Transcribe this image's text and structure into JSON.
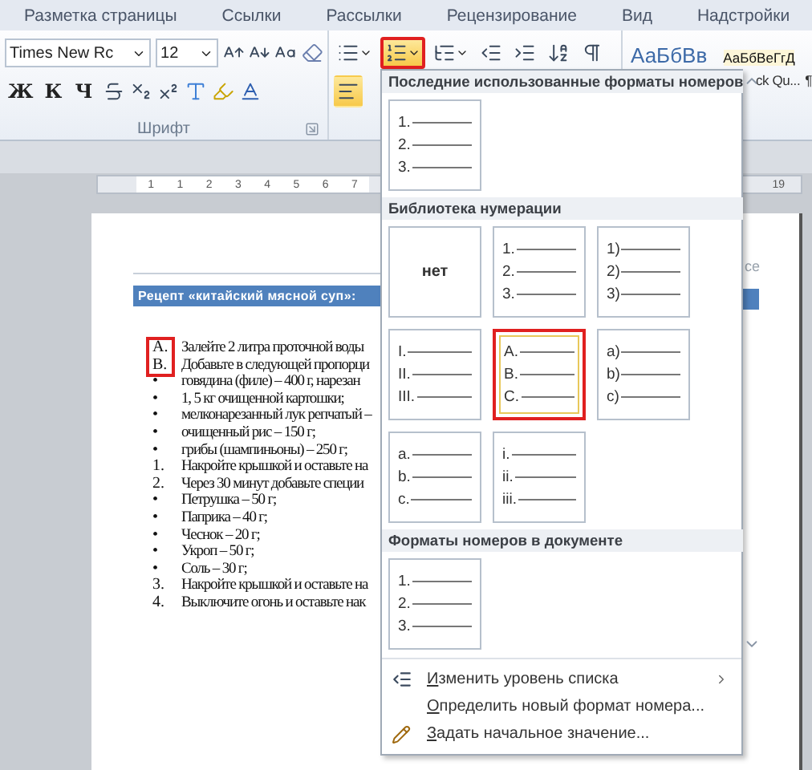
{
  "ribbon_tabs": [
    "Разметка страницы",
    "Ссылки",
    "Рассылки",
    "Рецензирование",
    "Вид",
    "Надстройки"
  ],
  "font_group": {
    "font_name": "Times New Rc",
    "font_size": "12",
    "style_letters": [
      "Ж",
      "К",
      "Ч"
    ],
    "label": "Шрифт"
  },
  "paragraph_buttons": [
    {
      "kind": "bullets",
      "selected": false,
      "annotated": false
    },
    {
      "kind": "numbering",
      "selected": true,
      "annotated": true
    },
    {
      "kind": "multilevel",
      "selected": false,
      "annotated": false
    },
    {
      "kind": "outdent",
      "selected": false,
      "annotated": false
    },
    {
      "kind": "indent",
      "selected": false,
      "annotated": false
    },
    {
      "kind": "sort",
      "selected": false,
      "annotated": false
    },
    {
      "kind": "pilcrow",
      "selected": false,
      "annotated": false
    }
  ],
  "align_buttons": [
    {
      "kind": "align-left",
      "selected": true
    }
  ],
  "styles_gallery": {
    "samples": [
      "АаБбВв",
      "АаБбВеГгД"
    ],
    "captions": [
      "ck Qu...",
      "¶"
    ]
  },
  "ruler": {
    "labels": [
      "1",
      "1",
      "2",
      "3",
      "4",
      "5",
      "6",
      "7"
    ],
    "right_label": "19"
  },
  "document": {
    "header_fragment": "ce",
    "heading": "Рецепт «китайский мясной суп»:",
    "items": [
      {
        "marker": "A.",
        "text": "Залейте 2 литра проточной воды",
        "annotated": true
      },
      {
        "marker": "B.",
        "text": "Добавьте в следующей пропорци",
        "annotated": true
      },
      {
        "marker": "•",
        "text": "говядина (филе) – 400 г, нарезан",
        "annotated": false
      },
      {
        "marker": "•",
        "text": "1, 5 кг очищенной картошки;",
        "annotated": false
      },
      {
        "marker": "•",
        "text": "мелконарезанный лук репчатый –",
        "annotated": false
      },
      {
        "marker": "•",
        "text": "очищенный рис – 150 г;",
        "annotated": false
      },
      {
        "marker": "•",
        "text": "грибы (шампиньоны) – 250 г;",
        "annotated": false
      },
      {
        "marker": "1.",
        "text": "Накройте крышкой и оставьте на",
        "annotated": false
      },
      {
        "marker": "2.",
        "text": "Через 30 минут добавьте специи",
        "annotated": false
      },
      {
        "marker": "•",
        "text": "Петрушка – 50 г;",
        "annotated": false
      },
      {
        "marker": "•",
        "text": "Паприка – 40 г;",
        "annotated": false
      },
      {
        "marker": "•",
        "text": "Чеснок – 20 г;",
        "annotated": false
      },
      {
        "marker": "•",
        "text": "Укроп – 50 г;",
        "annotated": false
      },
      {
        "marker": "•",
        "text": "Соль – 30 г;",
        "annotated": false
      },
      {
        "marker": "3.",
        "text": "Накройте крышкой и оставьте на",
        "annotated": false
      },
      {
        "marker": "4.",
        "text": "Выключите огонь и оставьте нак",
        "annotated": false
      }
    ]
  },
  "numbering_menu": {
    "recent_header": "Последние использованные форматы номеров",
    "recent_formats": [
      {
        "kind": "list",
        "markers": [
          "1.",
          "2.",
          "3."
        ],
        "selected": false,
        "annotated": false
      }
    ],
    "library_header": "Библиотека нумерации",
    "library_formats": [
      {
        "kind": "none",
        "label": "нет",
        "selected": false,
        "annotated": false
      },
      {
        "kind": "list",
        "markers": [
          "1.",
          "2.",
          "3."
        ],
        "selected": false,
        "annotated": false
      },
      {
        "kind": "list",
        "markers": [
          "1)",
          "2)",
          "3)"
        ],
        "selected": false,
        "annotated": false
      },
      {
        "kind": "list",
        "markers": [
          "I.",
          "II.",
          "III."
        ],
        "selected": false,
        "annotated": false
      },
      {
        "kind": "list",
        "markers": [
          "A.",
          "B.",
          "C."
        ],
        "selected": true,
        "annotated": true
      },
      {
        "kind": "list",
        "markers": [
          "a)",
          "b)",
          "c)"
        ],
        "selected": false,
        "annotated": false
      },
      {
        "kind": "list",
        "markers": [
          "a.",
          "b.",
          "c."
        ],
        "selected": false,
        "annotated": false
      },
      {
        "kind": "list",
        "markers": [
          "i.",
          "ii.",
          "iii."
        ],
        "selected": false,
        "annotated": false
      }
    ],
    "document_header": "Форматы номеров в документе",
    "document_formats": [
      {
        "kind": "list",
        "markers": [
          "1.",
          "2.",
          "3."
        ],
        "selected": false,
        "annotated": false
      }
    ],
    "commands": [
      {
        "kind": "level",
        "label": "Изменить уровень списка",
        "submenu": true
      },
      {
        "kind": "plain",
        "label": "Определить новый формат номера...",
        "submenu": false
      },
      {
        "kind": "start",
        "label": "Задать начальное значение...",
        "submenu": false
      }
    ]
  }
}
